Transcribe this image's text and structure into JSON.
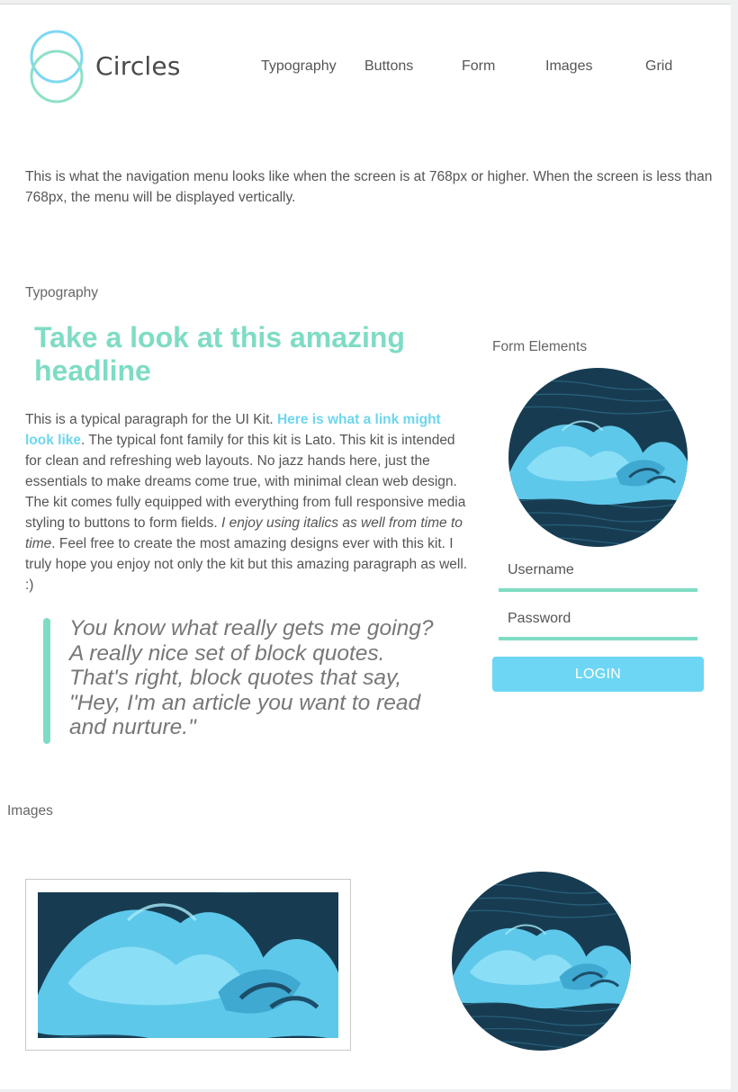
{
  "header": {
    "brand": "Circles",
    "nav": [
      "Typography",
      "Buttons",
      "Form",
      "Images",
      "Grid"
    ]
  },
  "intro_text": "This is what the navigation menu looks like when the screen is at 768px or higher. When the screen is less than 768px, the menu will be displayed vertically.",
  "typography": {
    "section_label": "Typography",
    "headline": "Take a look at this amazing headline",
    "paragraph": {
      "part1": "This is a typical paragraph for the UI Kit. ",
      "link": "Here is what a link might look like",
      "part2": ". The typical font family for this kit is Lato. This kit is intended for clean and refreshing web layouts. No jazz hands here, just the essentials to make dreams come true, with minimal clean web design. The kit comes fully equipped with everything from full responsive media styling to buttons to form fields. ",
      "italic": "I enjoy using italics as well from time to time",
      "part3": ". Feel free to create the most amazing designs ever with this kit. I truly hope you enjoy not only the kit but this amazing paragraph as well. :)"
    },
    "blockquote": "You know what really gets me going? A really nice set of block quotes. That's right, block quotes that say, \"Hey, I'm an article you want to read and nurture.\""
  },
  "form": {
    "section_label": "Form Elements",
    "username_placeholder": "Username",
    "password_placeholder": "Password",
    "login_label": "LOGIN"
  },
  "images": {
    "section_label": "Images"
  },
  "colors": {
    "accent_green": "#7fdcc4",
    "accent_blue": "#6dd6f4",
    "link_blue": "#6dd6ee",
    "logo_ring_blue": "#7dd8f2",
    "logo_ring_green": "#8ee0c8"
  },
  "icons": {
    "logo": "two-overlapping-circles-icon"
  }
}
